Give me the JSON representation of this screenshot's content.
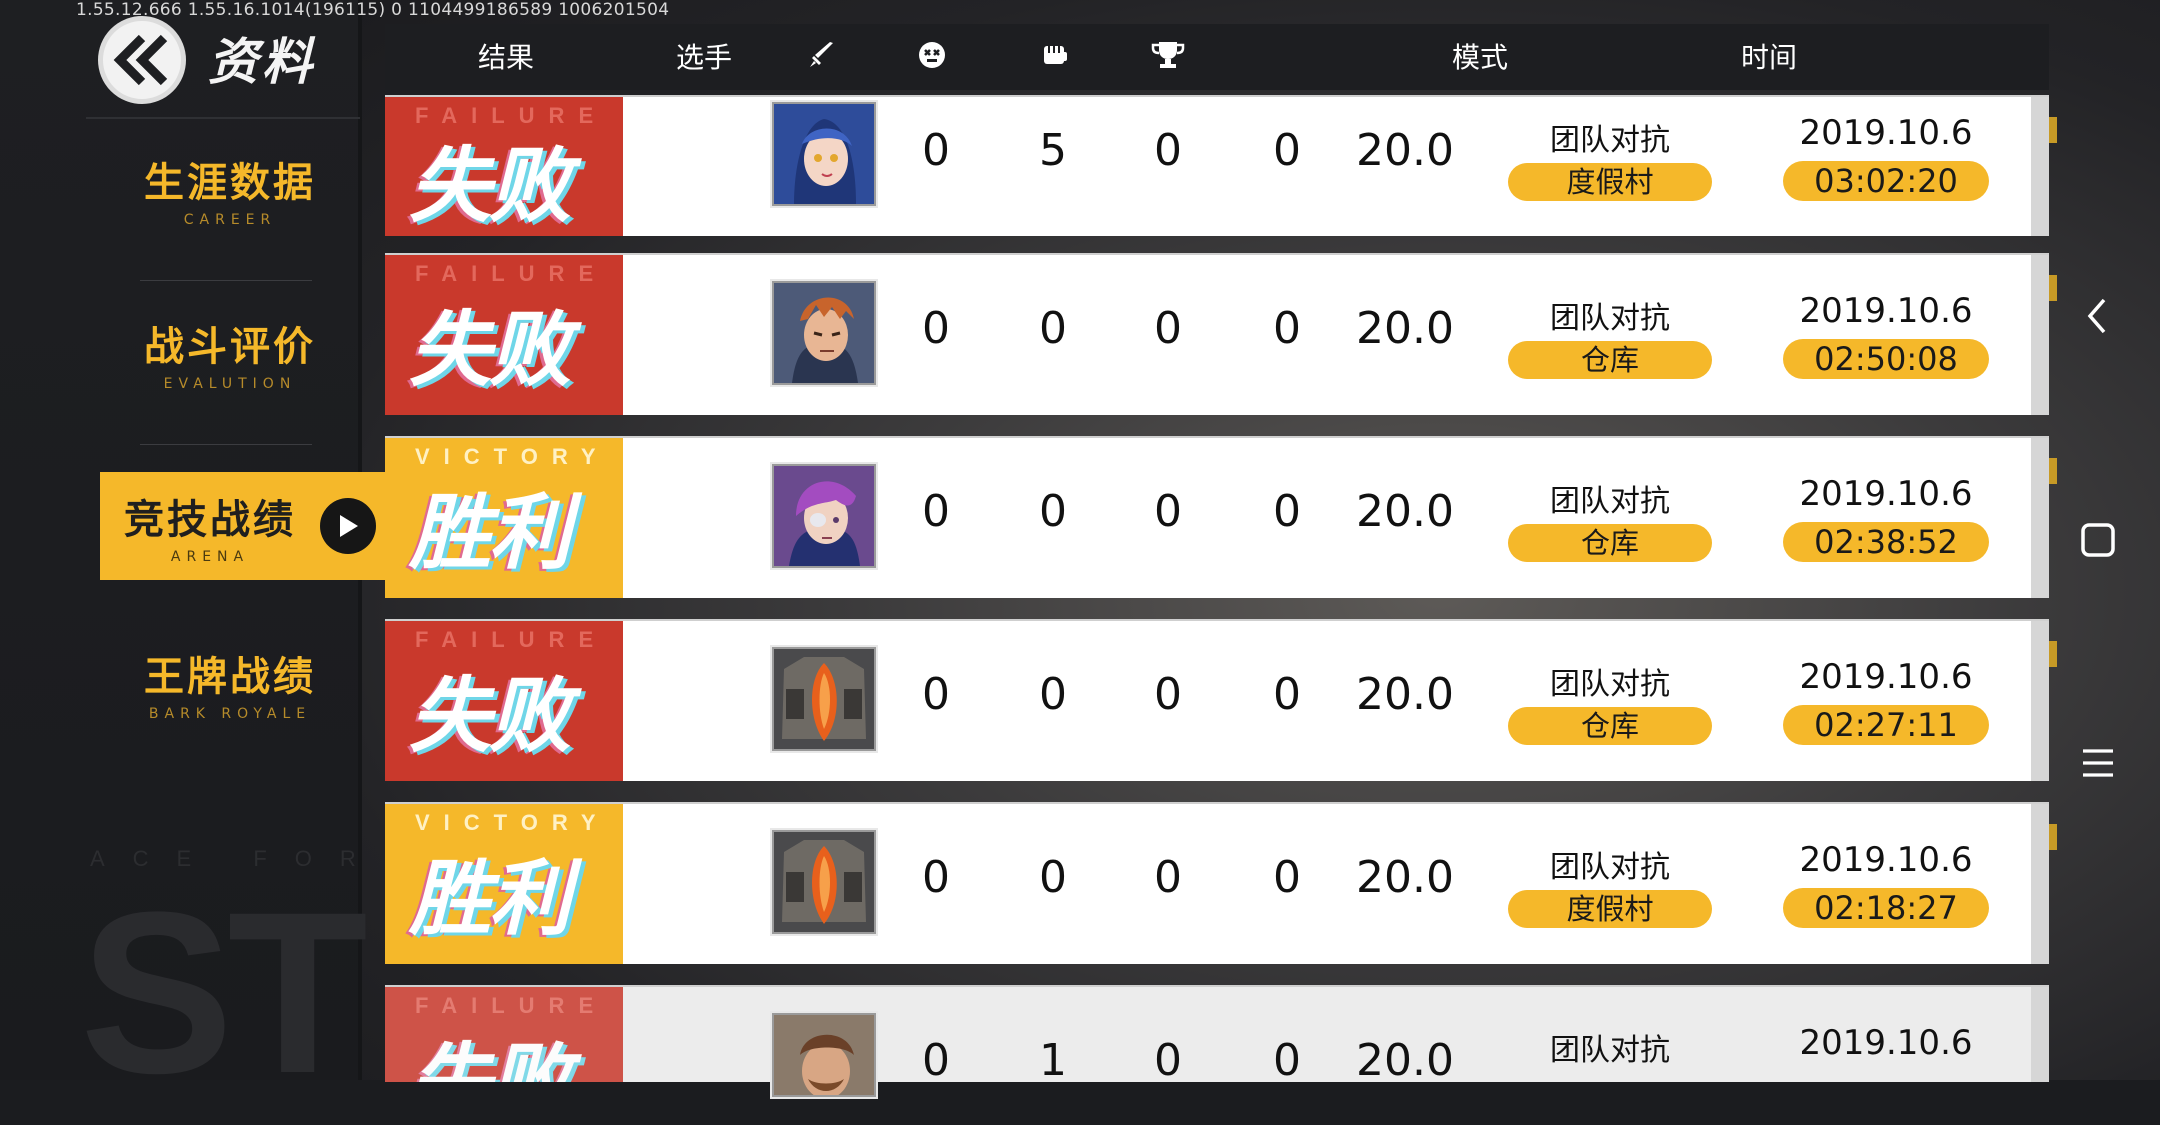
{
  "debug_text": "1.55.12.666  1.55.16.1014(196115)  0  1104499186589    1006201504",
  "header": {
    "title": "资料"
  },
  "background": {
    "deco_large": "ST",
    "deco_small": "ACE FORCE"
  },
  "sidebar": {
    "items": [
      {
        "zh": "生涯数据",
        "en": "CAREER",
        "active": false
      },
      {
        "zh": "战斗评价",
        "en": "EVALUTION",
        "active": false
      },
      {
        "zh": "竞技战绩",
        "en": "ARENA",
        "active": true
      },
      {
        "zh": "王牌战绩",
        "en": "BARK ROYALE",
        "active": false
      }
    ]
  },
  "table": {
    "headers": {
      "result": "结果",
      "player": "选手",
      "mode": "模式",
      "time": "时间"
    },
    "header_icons": [
      "sword-icon",
      "skull-icon",
      "fist-icon",
      "trophy-icon"
    ],
    "rows": [
      {
        "result": "failure",
        "result_en": "FAILURE",
        "result_zh": "失败",
        "portrait": "blue-hair-girl",
        "kills": "0",
        "deaths": "5",
        "assists": "0",
        "mvp": "0",
        "score": "20.0",
        "mode": "团队对抗",
        "map": "度假村",
        "date": "2019.10.6",
        "time": "03:02:20"
      },
      {
        "result": "failure",
        "result_en": "FAILURE",
        "result_zh": "失败",
        "portrait": "ginger-man",
        "kills": "0",
        "deaths": "0",
        "assists": "0",
        "mvp": "0",
        "score": "20.0",
        "mode": "团队对抗",
        "map": "仓库",
        "date": "2019.10.6",
        "time": "02:50:08"
      },
      {
        "result": "victory",
        "result_en": "VICTORY",
        "result_zh": "胜利",
        "portrait": "purple-hair-eyepatch",
        "kills": "0",
        "deaths": "0",
        "assists": "0",
        "mvp": "0",
        "score": "20.0",
        "mode": "团队对抗",
        "map": "仓库",
        "date": "2019.10.6",
        "time": "02:38:52"
      },
      {
        "result": "failure",
        "result_en": "FAILURE",
        "result_zh": "失败",
        "portrait": "orange-mech",
        "kills": "0",
        "deaths": "0",
        "assists": "0",
        "mvp": "0",
        "score": "20.0",
        "mode": "团队对抗",
        "map": "仓库",
        "date": "2019.10.6",
        "time": "02:27:11"
      },
      {
        "result": "victory",
        "result_en": "VICTORY",
        "result_zh": "胜利",
        "portrait": "orange-mech",
        "kills": "0",
        "deaths": "0",
        "assists": "0",
        "mvp": "0",
        "score": "20.0",
        "mode": "团队对抗",
        "map": "度假村",
        "date": "2019.10.6",
        "time": "02:18:27"
      },
      {
        "result": "failure",
        "result_en": "FAILURE",
        "result_zh": "失败",
        "portrait": "bearded-man",
        "kills": "0",
        "deaths": "1",
        "assists": "0",
        "mvp": "0",
        "score": "20.0",
        "mode": "团队对抗",
        "map": "",
        "date": "2019.10.6",
        "time": ""
      }
    ]
  },
  "system_nav": [
    "back-icon",
    "home-square-icon",
    "menu-icon"
  ],
  "colors": {
    "accent": "#f5b82a",
    "failure": "#c9392c",
    "panel": "#1d1e21"
  }
}
